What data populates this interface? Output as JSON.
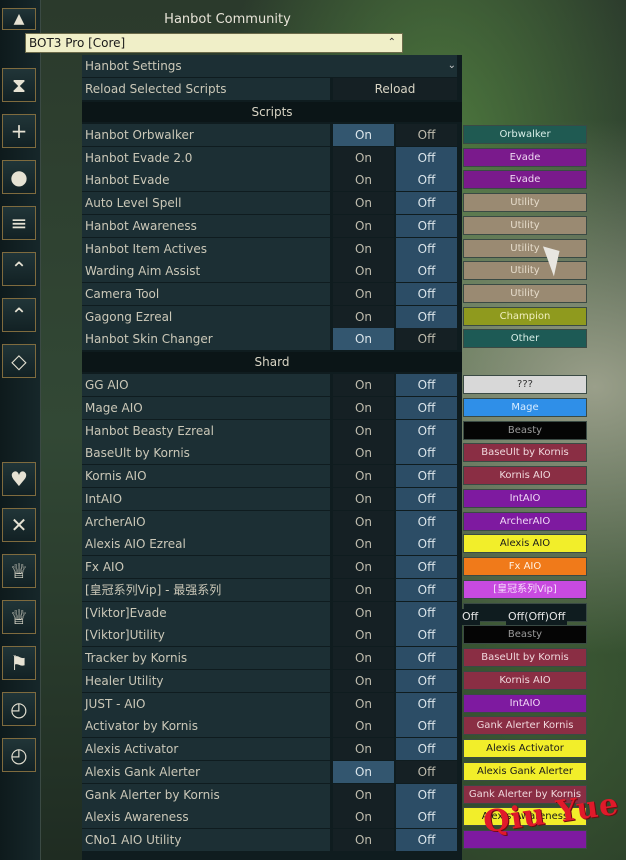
{
  "header": {
    "community_title": "Hanbot Community",
    "core_select": "BOT3 Pro [Core]"
  },
  "sidebar_icons": [
    "chevron-up-icon",
    "hourglass-icon",
    "plus-icon",
    "drop-icon",
    "coins-icon",
    "double-chevron-up-icon",
    "lock-chevron-icon",
    "diamond-icon",
    "heart-icon",
    "close-icon",
    "trophy-icon",
    "trophy-icon",
    "flag-icon",
    "clock-icon",
    "clock-icon"
  ],
  "menu": {
    "settings_label": "Hanbot Settings",
    "reload_row_label": "Reload Selected Scripts",
    "reload_button": "Reload",
    "scripts_header": "Scripts",
    "shard_header": "Shard"
  },
  "scripts": [
    {
      "name": "Hanbot Orbwalker",
      "on": "On",
      "off": "Off",
      "state": "on",
      "tag": "Orbwalker",
      "tag_bg": "#1f5a52",
      "tag_fg": "#d8efe8"
    },
    {
      "name": "Hanbot Evade 2.0",
      "on": "On",
      "off": "Off",
      "state": "off",
      "tag": "Evade",
      "tag_bg": "#7a1a8c",
      "tag_fg": "#efd8f2"
    },
    {
      "name": "Hanbot Evade",
      "on": "On",
      "off": "Off",
      "state": "off",
      "tag": "Evade",
      "tag_bg": "#7a1a8c",
      "tag_fg": "#efd8f2"
    },
    {
      "name": "Auto Level Spell",
      "on": "On",
      "off": "Off",
      "state": "off",
      "tag": "Utility",
      "tag_bg": "#9a8a72",
      "tag_fg": "#e6dccb"
    },
    {
      "name": "Hanbot Awareness",
      "on": "On",
      "off": "Off",
      "state": "off",
      "tag": "Utility",
      "tag_bg": "#9a8a72",
      "tag_fg": "#e6dccb"
    },
    {
      "name": "Hanbot Item Actives",
      "on": "On",
      "off": "Off",
      "state": "off",
      "tag": "Utility",
      "tag_bg": "#9a8a72",
      "tag_fg": "#e6dccb"
    },
    {
      "name": "Warding Aim Assist",
      "on": "On",
      "off": "Off",
      "state": "off",
      "tag": "Utility",
      "tag_bg": "#9a8a72",
      "tag_fg": "#e6dccb"
    },
    {
      "name": "Camera Tool",
      "on": "On",
      "off": "Off",
      "state": "off",
      "tag": "Utility",
      "tag_bg": "#9a8a72",
      "tag_fg": "#e6dccb"
    },
    {
      "name": "Gagong Ezreal",
      "on": "On",
      "off": "Off",
      "state": "off",
      "tag": "Champion",
      "tag_bg": "#8f9a1e",
      "tag_fg": "#f2f0c0"
    },
    {
      "name": "Hanbot Skin Changer",
      "on": "On",
      "off": "Off",
      "state": "on",
      "tag": "Other",
      "tag_bg": "#1d5a55",
      "tag_fg": "#d8efe8"
    }
  ],
  "shard": [
    {
      "name": "GG AIO",
      "on": "On",
      "off": "Off",
      "state": "off",
      "tag": "???",
      "tag_bg": "#d8d8d8",
      "tag_fg": "#333333"
    },
    {
      "name": "Mage AIO",
      "on": "On",
      "off": "Off",
      "state": "off",
      "tag": "Mage",
      "tag_bg": "#2f8fe8",
      "tag_fg": "#d8ecff"
    },
    {
      "name": "Hanbot Beasty Ezreal",
      "on": "On",
      "off": "Off",
      "state": "off",
      "tag": "Beasty",
      "tag_bg": "#050505",
      "tag_fg": "#9a9a9a"
    },
    {
      "name": "BaseUlt by Kornis",
      "on": "On",
      "off": "Off",
      "state": "off",
      "tag": "BaseUlt by Kornis",
      "tag_bg": "#8a2e44",
      "tag_fg": "#f0d8dd"
    },
    {
      "name": "Kornis AIO",
      "on": "On",
      "off": "Off",
      "state": "off",
      "tag": "Kornis AIO",
      "tag_bg": "#8a2e44",
      "tag_fg": "#f0d8dd"
    },
    {
      "name": "IntAIO",
      "on": "On",
      "off": "Off",
      "state": "off",
      "tag": "IntAIO",
      "tag_bg": "#7e1aa0",
      "tag_fg": "#f0d8f6"
    },
    {
      "name": "ArcherAIO",
      "on": "On",
      "off": "Off",
      "state": "off",
      "tag": "ArcherAIO",
      "tag_bg": "#7e1aa0",
      "tag_fg": "#f0d8f6"
    },
    {
      "name": "Alexis AIO Ezreal",
      "on": "On",
      "off": "Off",
      "state": "off",
      "tag": "Alexis AIO",
      "tag_bg": "#f2ee2a",
      "tag_fg": "#1a1a1a"
    },
    {
      "name": "Fx AIO",
      "on": "On",
      "off": "Off",
      "state": "off",
      "tag": "Fx AIO",
      "tag_bg": "#f07a1a",
      "tag_fg": "#fff0e0"
    },
    {
      "name": "[皇冠系列Vip] - 最强系列",
      "on": "On",
      "off": "Off",
      "state": "off",
      "tag": "[皇冠系列Vip]",
      "tag_bg": "#c84ae0",
      "tag_fg": "#f6e0fa"
    },
    {
      "name": "[Viktor]Evade",
      "on": "On",
      "off": "Off",
      "state": "off",
      "tag": "",
      "tag_bg": "#0f1c1f",
      "tag_fg": "#ffffff"
    },
    {
      "name": "[Viktor]Utility",
      "on": "On",
      "off": "Off",
      "state": "off",
      "tag": "Beasty",
      "tag_bg": "#050505",
      "tag_fg": "#9a9a9a"
    },
    {
      "name": "Tracker by Kornis",
      "on": "On",
      "off": "Off",
      "state": "off",
      "tag": "BaseUlt by Kornis",
      "tag_bg": "#8a2e44",
      "tag_fg": "#f0d8dd"
    },
    {
      "name": "Healer Utility",
      "on": "On",
      "off": "Off",
      "state": "off",
      "tag": "Kornis AIO",
      "tag_bg": "#8a2e44",
      "tag_fg": "#f0d8dd"
    },
    {
      "name": "JUST - AIO",
      "on": "On",
      "off": "Off",
      "state": "off",
      "tag": "IntAIO",
      "tag_bg": "#7e1aa0",
      "tag_fg": "#f0d8f6"
    },
    {
      "name": "Activator by Kornis",
      "on": "On",
      "off": "Off",
      "state": "off",
      "tag": "Gank Alerter Kornis",
      "tag_bg": "#8a2e44",
      "tag_fg": "#f0d8dd"
    },
    {
      "name": "Alexis Activator",
      "on": "On",
      "off": "Off",
      "state": "off",
      "tag": "Alexis Activator",
      "tag_bg": "#f2ee2a",
      "tag_fg": "#1a1a1a"
    },
    {
      "name": "Alexis Gank Alerter",
      "on": "On",
      "off": "Off",
      "state": "on",
      "tag": "Alexis Gank Alerter",
      "tag_bg": "#f2ee2a",
      "tag_fg": "#1a1a1a"
    },
    {
      "name": "Gank Alerter by Kornis",
      "on": "On",
      "off": "Off",
      "state": "off",
      "tag": "Gank Alerter by Kornis",
      "tag_bg": "#8a2e44",
      "tag_fg": "#f0d8dd"
    },
    {
      "name": "Alexis Awareness",
      "on": "On",
      "off": "Off",
      "state": "off",
      "tag": "Alexis Awareness",
      "tag_bg": "#f2ee2a",
      "tag_fg": "#1a1a1a"
    },
    {
      "name": "CNo1 AIO Utility",
      "on": "On",
      "off": "Off",
      "state": "off",
      "tag": "",
      "tag_bg": "#7e1aa0",
      "tag_fg": "#f0d8f6"
    }
  ],
  "overlays": {
    "stray_off_left": "Off",
    "stray_off_stack": "Off(Off)Off",
    "watermark": "Qiu Yue"
  }
}
